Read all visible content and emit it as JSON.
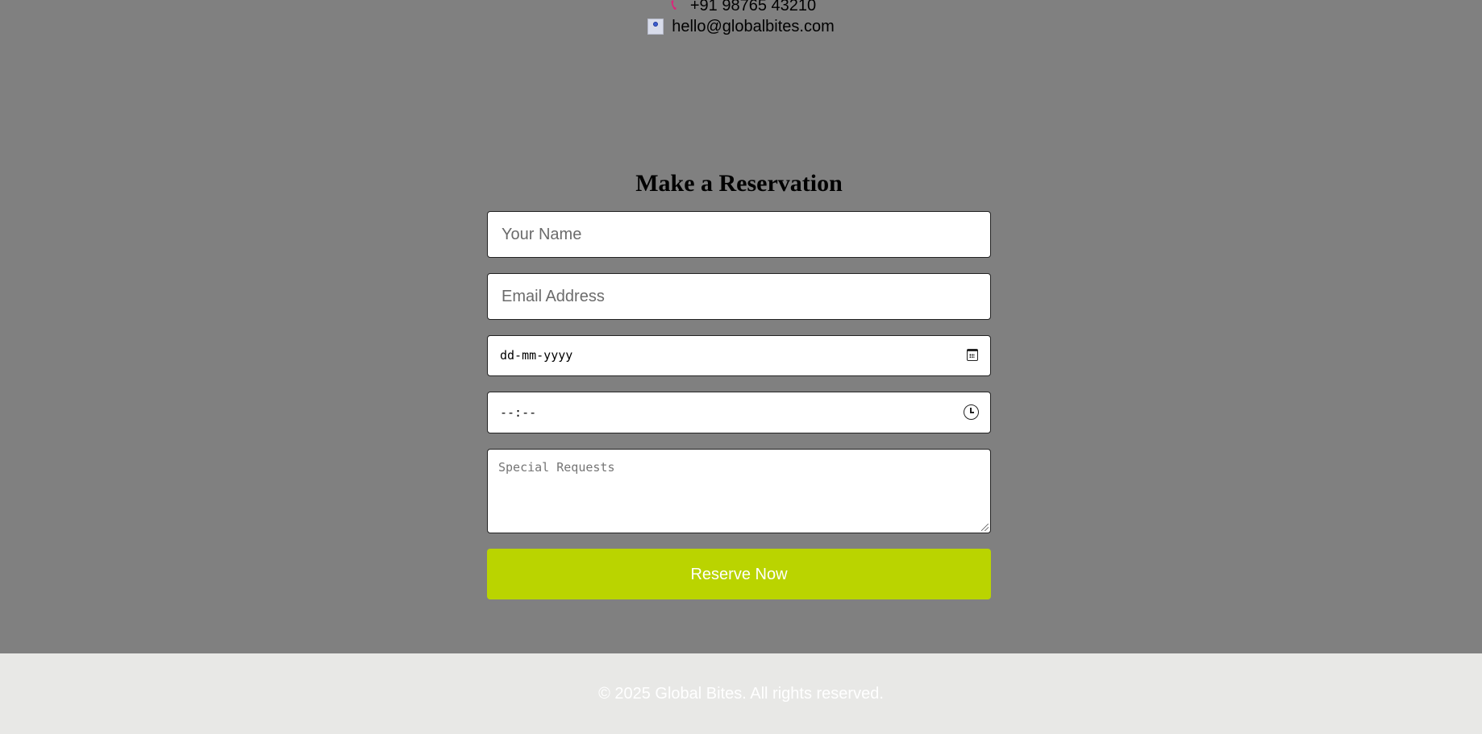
{
  "contact": {
    "phone": "+91 98765 43210",
    "email": "hello@globalbites.com",
    "phone_icon": "phone-icon",
    "email_icon": "email-icon"
  },
  "reservation": {
    "title": "Make a Reservation",
    "name_placeholder": "Your Name",
    "email_placeholder": "Email Address",
    "date_placeholder": "dd-mm-yyyy",
    "time_placeholder": "--:--",
    "requests_placeholder": "Special Requests",
    "submit_label": "Reserve Now"
  },
  "footer": {
    "copyright": "© 2025 Global Bites. All rights reserved."
  },
  "colors": {
    "background": "#808080",
    "accent": "#bad400",
    "footer_bg": "#e8e8e6"
  }
}
